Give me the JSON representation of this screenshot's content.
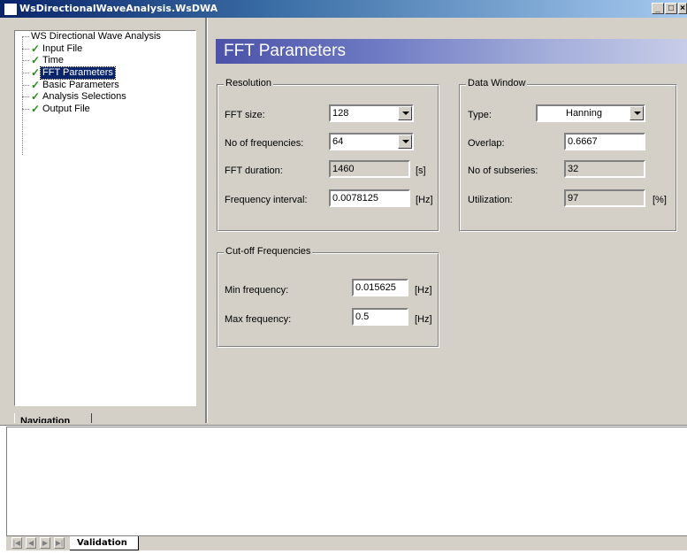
{
  "window": {
    "title": "WsDirectionalWaveAnalysis.WsDWA",
    "controls": [
      "_",
      "□",
      "×"
    ]
  },
  "navigation": {
    "tab_label": "Navigation",
    "root": "WS Directional Wave Analysis",
    "items": [
      {
        "label": "Input File",
        "checked": true,
        "selected": false
      },
      {
        "label": "Time",
        "checked": true,
        "selected": false
      },
      {
        "label": "FFT Parameters",
        "checked": true,
        "selected": true
      },
      {
        "label": "Basic Parameters",
        "checked": true,
        "selected": false
      },
      {
        "label": "Analysis Selections",
        "checked": true,
        "selected": false
      },
      {
        "label": "Output File",
        "checked": true,
        "selected": false
      }
    ]
  },
  "page": {
    "title": "FFT Parameters",
    "resolution": {
      "label": "Resolution",
      "fft_size": {
        "label": "FFT size:",
        "value": "128"
      },
      "no_frequencies": {
        "label": "No of frequencies:",
        "value": "64"
      },
      "fft_duration": {
        "label": "FFT duration:",
        "value": "1460",
        "unit": "[s]"
      },
      "frequency_interval": {
        "label": "Frequency interval:",
        "value": "0.0078125",
        "unit": "[Hz]"
      }
    },
    "data_window": {
      "label": "Data Window",
      "type": {
        "label": "Type:",
        "value": "Hanning"
      },
      "overlap": {
        "label": "Overlap:",
        "value": "0.6667"
      },
      "no_subseries": {
        "label": "No of subseries:",
        "value": "32"
      },
      "utilization": {
        "label": "Utilization:",
        "value": "97",
        "unit": "[%]"
      }
    },
    "cutoff": {
      "label": "Cut-off Frequencies",
      "min_frequency": {
        "label": "Min frequency:",
        "value": "0.015625",
        "unit": "[Hz]"
      },
      "max_frequency": {
        "label": "Max frequency:",
        "value": "0.5",
        "unit": "[Hz]"
      }
    }
  },
  "bottom": {
    "tab_label": "Validation",
    "nav_buttons": [
      "|◀",
      "◀",
      "▶",
      "▶|"
    ]
  },
  "colors": {
    "titlebar": "#0a246a",
    "banner": "#4b52a8",
    "selection": "#0a246a",
    "check": "#2a8a1a"
  }
}
